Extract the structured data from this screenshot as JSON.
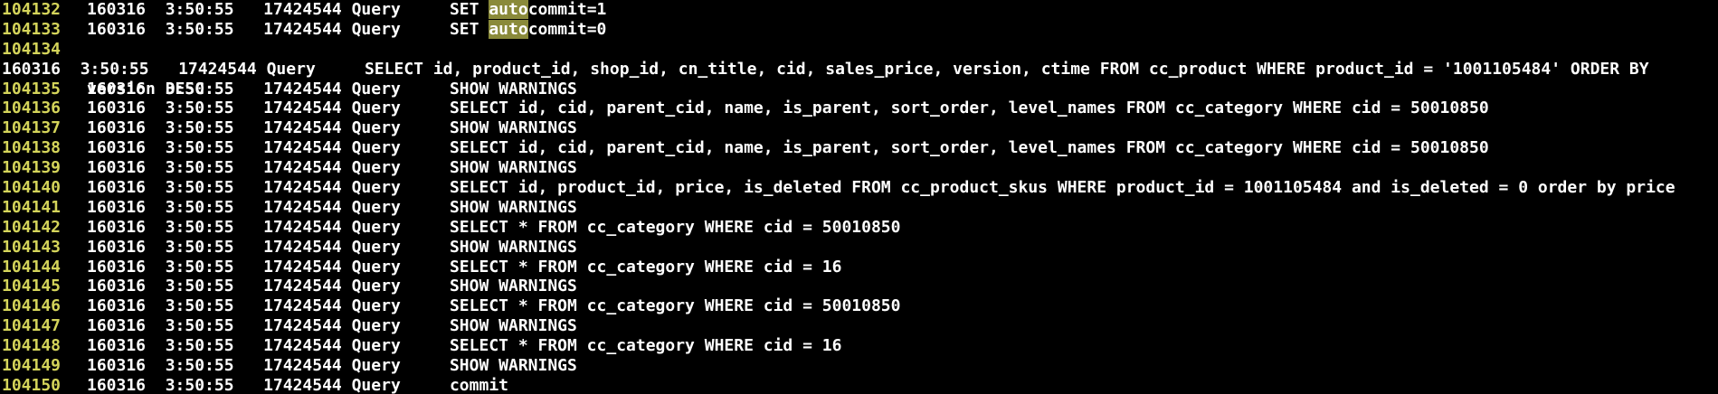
{
  "log_lines": [
    {
      "num": "104132",
      "text": "160316  3:50:55   17424544 Query     SET ",
      "hl": "auto",
      "rest": "commit=1"
    },
    {
      "num": "104133",
      "text": "160316  3:50:55   17424544 Query     SET ",
      "hl": "auto",
      "rest": "commit=0"
    },
    {
      "num": "104134",
      "text": "160316  3:50:55   17424544 Query     SELECT id, product_id, shop_id, cn_title, cid, sales_price, version, ctime FROM cc_product WHERE product_id = '1001105484' ORDER BY",
      "cont": "version DESC"
    },
    {
      "num": "104135",
      "text": "160316  3:50:55   17424544 Query     SHOW WARNINGS"
    },
    {
      "num": "104136",
      "text": "160316  3:50:55   17424544 Query     SELECT id, cid, parent_cid, name, is_parent, sort_order, level_names FROM cc_category WHERE cid = 50010850"
    },
    {
      "num": "104137",
      "text": "160316  3:50:55   17424544 Query     SHOW WARNINGS"
    },
    {
      "num": "104138",
      "text": "160316  3:50:55   17424544 Query     SELECT id, cid, parent_cid, name, is_parent, sort_order, level_names FROM cc_category WHERE cid = 50010850"
    },
    {
      "num": "104139",
      "text": "160316  3:50:55   17424544 Query     SHOW WARNINGS"
    },
    {
      "num": "104140",
      "text": "160316  3:50:55   17424544 Query     SELECT id, product_id, price, is_deleted FROM cc_product_skus WHERE product_id = 1001105484 and is_deleted = 0 order by price"
    },
    {
      "num": "104141",
      "text": "160316  3:50:55   17424544 Query     SHOW WARNINGS"
    },
    {
      "num": "104142",
      "text": "160316  3:50:55   17424544 Query     SELECT * FROM cc_category WHERE cid = 50010850"
    },
    {
      "num": "104143",
      "text": "160316  3:50:55   17424544 Query     SHOW WARNINGS"
    },
    {
      "num": "104144",
      "text": "160316  3:50:55   17424544 Query     SELECT * FROM cc_category WHERE cid = 16"
    },
    {
      "num": "104145",
      "text": "160316  3:50:55   17424544 Query     SHOW WARNINGS"
    },
    {
      "num": "104146",
      "text": "160316  3:50:55   17424544 Query     SELECT * FROM cc_category WHERE cid = 50010850"
    },
    {
      "num": "104147",
      "text": "160316  3:50:55   17424544 Query     SHOW WARNINGS"
    },
    {
      "num": "104148",
      "text": "160316  3:50:55   17424544 Query     SELECT * FROM cc_category WHERE cid = 16"
    },
    {
      "num": "104149",
      "text": "160316  3:50:55   17424544 Query     SHOW WARNINGS"
    },
    {
      "num": "104150",
      "text": "160316  3:50:55   17424544 Query     commit"
    }
  ],
  "colors": {
    "background": "#000000",
    "text": "#ffffff",
    "line_number": "#d4d45a",
    "search_highlight": "#8a8a3a"
  }
}
